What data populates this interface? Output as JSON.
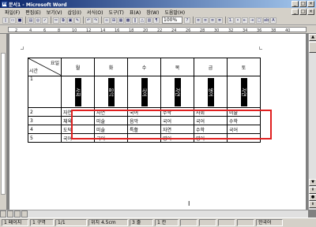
{
  "window": {
    "title": "문서1 - Microsoft Word"
  },
  "menu": [
    "파일(F)",
    "편집(E)",
    "보기(V)",
    "삽입(I)",
    "서식(O)",
    "도구(T)",
    "표(A)",
    "창(W)",
    "도움말(H)"
  ],
  "toolbar": {
    "zoom": "100%"
  },
  "ruler": {
    "ticks": [
      "2",
      "4",
      "6",
      "8",
      "10",
      "12",
      "14",
      "16",
      "18",
      "20",
      "22",
      "24",
      "26",
      "28",
      "30",
      "32",
      "34",
      "36",
      "38",
      "40"
    ]
  },
  "table": {
    "corner_top": "요일",
    "corner_bottom": "시간",
    "days": [
      "월",
      "화",
      "수",
      "목",
      "금",
      "토"
    ],
    "rows": [
      {
        "period": "1",
        "cells": [
          "사회",
          "음악",
          "국어",
          "자연",
          "영어",
          "자연"
        ]
      },
      {
        "period": "2",
        "cells": [
          "자연",
          "자연",
          "국어",
          "수학",
          "사회",
          "미술"
        ]
      },
      {
        "period": "3",
        "cells": [
          "체육",
          "미술",
          "음악",
          "국어",
          "국어",
          "수학"
        ]
      },
      {
        "period": "4",
        "cells": [
          "도덕",
          "미술",
          "특활",
          "자연",
          "수학",
          "국어"
        ]
      },
      {
        "period": "5",
        "cells": [
          "국어",
          "국어",
          "",
          "영어",
          "영어",
          ""
        ]
      }
    ]
  },
  "status": {
    "page": "1 페이지",
    "section": "1 구역",
    "pages": "1/1",
    "position": "위치 4.5cm",
    "line": "3 줄",
    "column": "1 칸",
    "lang": "한국어"
  }
}
